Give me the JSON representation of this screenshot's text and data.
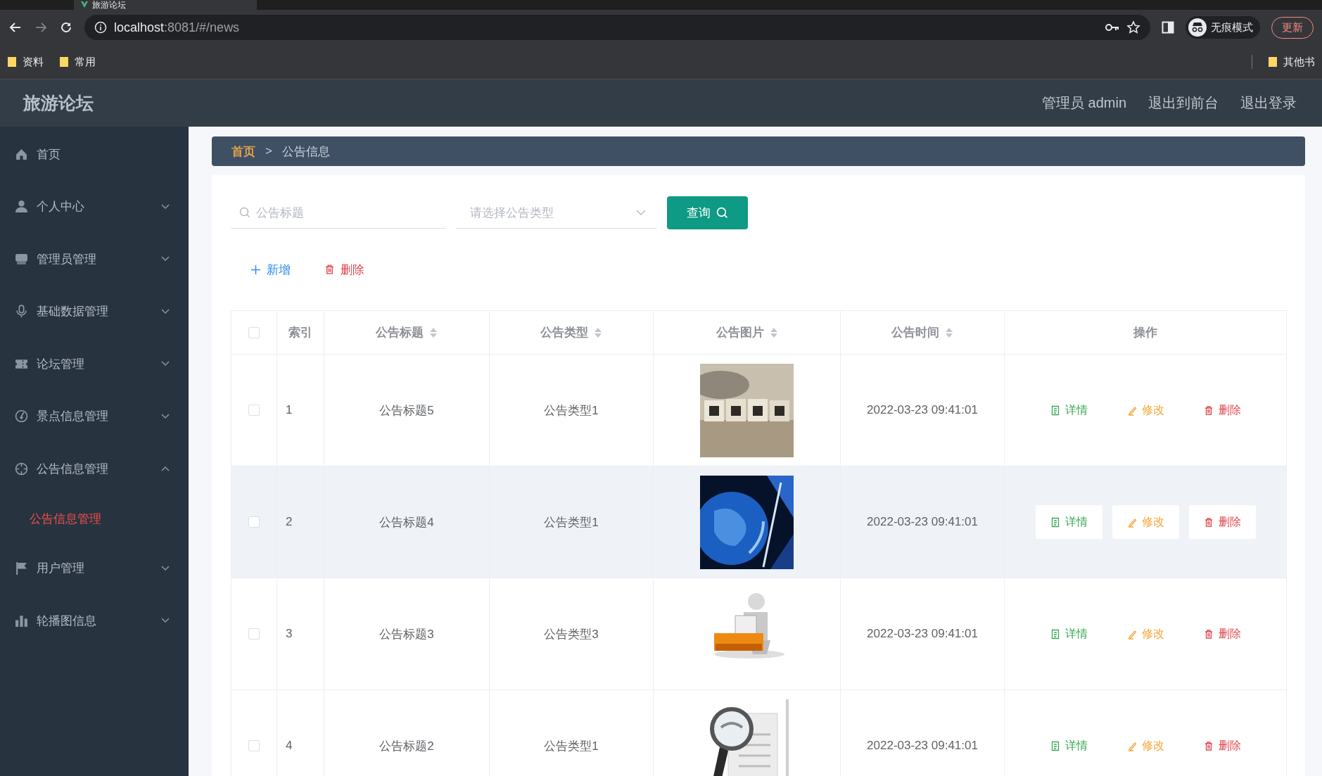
{
  "browser": {
    "tab_title": "旅游论坛",
    "url_host": "localhost",
    "url_path": ":8081/#/news",
    "bookmarks": [
      "资料",
      "常用"
    ],
    "other_bookmarks": "其他书",
    "incognito_label": "无痕模式",
    "update_button": "更新"
  },
  "header": {
    "title": "旅游论坛",
    "links": [
      "管理员 admin",
      "退出到前台",
      "退出登录"
    ]
  },
  "sidebar": {
    "items": [
      {
        "label": "首页",
        "kind": "link"
      },
      {
        "label": "个人中心",
        "kind": "menu",
        "expanded": false
      },
      {
        "label": "管理员管理",
        "kind": "menu",
        "expanded": false
      },
      {
        "label": "基础数据管理",
        "kind": "menu",
        "expanded": false
      },
      {
        "label": "论坛管理",
        "kind": "menu",
        "expanded": false
      },
      {
        "label": "景点信息管理",
        "kind": "menu",
        "expanded": false
      },
      {
        "label": "公告信息管理",
        "kind": "menu",
        "expanded": true,
        "children": [
          {
            "label": "公告信息管理",
            "selected": true
          }
        ]
      },
      {
        "label": "用户管理",
        "kind": "menu",
        "expanded": false
      },
      {
        "label": "轮播图信息",
        "kind": "menu",
        "expanded": false
      }
    ]
  },
  "breadcrumb": {
    "separator": ">",
    "items": [
      {
        "label": "首页",
        "selected": false
      },
      {
        "label": "公告信息",
        "selected": true
      }
    ]
  },
  "filters": {
    "title_placeholder": "公告标题",
    "type_placeholder": "请选择公告类型",
    "query_button": "查询"
  },
  "actions": {
    "add_button": "新增",
    "delete_button": "删除"
  },
  "table": {
    "header_checked": false,
    "columns": [
      {
        "label": "索引",
        "sortable": false
      },
      {
        "label": "公告标题",
        "sortable": true
      },
      {
        "label": "公告类型",
        "sortable": true
      },
      {
        "label": "公告图片",
        "sortable": true
      },
      {
        "label": "公告时间",
        "sortable": true
      },
      {
        "label": "操作",
        "sortable": false
      }
    ],
    "rows": [
      {
        "checked": false,
        "hovered": false,
        "index": "1",
        "title": "公告标题5",
        "type": "公告类型1",
        "image": {
          "kind": "picture"
        },
        "time": "2022-03-23 09:41:01",
        "buttons": [
          "详情",
          "修改",
          "删除"
        ]
      },
      {
        "checked": false,
        "hovered": true,
        "index": "2",
        "title": "公告标题4",
        "type": "公告类型1",
        "image": {
          "kind": "picture"
        },
        "time": "2022-03-23 09:41:01",
        "buttons": [
          "详情",
          "修改",
          "删除"
        ]
      },
      {
        "checked": false,
        "hovered": false,
        "index": "3",
        "title": "公告标题3",
        "type": "公告类型3",
        "image": {
          "kind": "picture"
        },
        "time": "2022-03-23 09:41:01",
        "buttons": [
          "详情",
          "修改",
          "删除"
        ]
      },
      {
        "checked": false,
        "hovered": false,
        "index": "4",
        "title": "公告标题2",
        "type": "公告类型1",
        "image": {
          "kind": "picture"
        },
        "time": "2022-03-23 09:41:01",
        "buttons": [
          "详情",
          "修改",
          "删除"
        ]
      }
    ]
  }
}
